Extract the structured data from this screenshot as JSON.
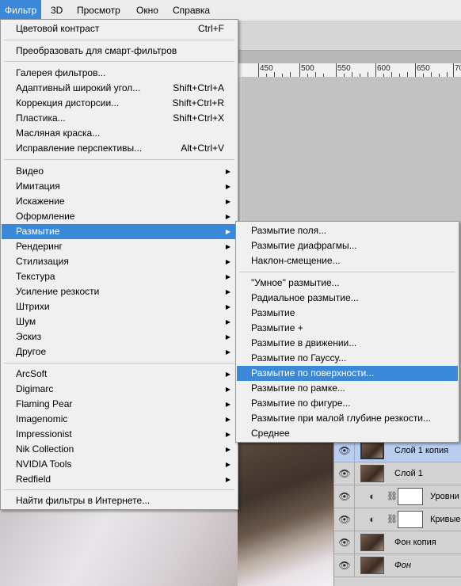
{
  "menubar": {
    "items": [
      {
        "label": "Фильтр",
        "active": true
      },
      {
        "label": "3D"
      },
      {
        "label": "Просмотр"
      },
      {
        "label": "Окно"
      },
      {
        "label": "Справка"
      }
    ]
  },
  "ruler": {
    "labels": [
      "450",
      "500",
      "550",
      "600",
      "650",
      "70"
    ]
  },
  "filter_menu": {
    "items": [
      {
        "label": "Цветовой контраст",
        "shortcut": "Ctrl+F"
      },
      {
        "label": "Преобразовать для смарт-фильтров"
      },
      {
        "label": "Галерея фильтров..."
      },
      {
        "label": "Адаптивный широкий угол...",
        "shortcut": "Shift+Ctrl+A"
      },
      {
        "label": "Коррекция дисторсии...",
        "shortcut": "Shift+Ctrl+R"
      },
      {
        "label": "Пластика...",
        "shortcut": "Shift+Ctrl+X"
      },
      {
        "label": "Масляная краска..."
      },
      {
        "label": "Исправление перспективы...",
        "shortcut": "Alt+Ctrl+V"
      },
      {
        "label": "Видео",
        "submenu": true
      },
      {
        "label": "Имитация",
        "submenu": true
      },
      {
        "label": "Искажение",
        "submenu": true
      },
      {
        "label": "Оформление",
        "submenu": true
      },
      {
        "label": "Размытие",
        "submenu": true,
        "highlighted": true
      },
      {
        "label": "Рендеринг",
        "submenu": true
      },
      {
        "label": "Стилизация",
        "submenu": true
      },
      {
        "label": "Текстура",
        "submenu": true
      },
      {
        "label": "Усиление резкости",
        "submenu": true
      },
      {
        "label": "Штрихи",
        "submenu": true
      },
      {
        "label": "Шум",
        "submenu": true
      },
      {
        "label": "Эскиз",
        "submenu": true
      },
      {
        "label": "Другое",
        "submenu": true
      },
      {
        "label": "ArcSoft",
        "submenu": true
      },
      {
        "label": "Digimarc",
        "submenu": true
      },
      {
        "label": "Flaming Pear",
        "submenu": true
      },
      {
        "label": "Imagenomic",
        "submenu": true
      },
      {
        "label": "Impressionist",
        "submenu": true
      },
      {
        "label": "Nik Collection",
        "submenu": true
      },
      {
        "label": "NVIDIA Tools",
        "submenu": true
      },
      {
        "label": "Redfield",
        "submenu": true
      },
      {
        "label": "Найти фильтры в Интернете..."
      }
    ]
  },
  "blur_submenu": {
    "items": [
      {
        "label": "Размытие поля..."
      },
      {
        "label": "Размытие диафрагмы..."
      },
      {
        "label": "Наклон-смещение..."
      },
      {
        "label": "\"Умное\" размытие..."
      },
      {
        "label": "Радиальное размытие..."
      },
      {
        "label": "Размытие"
      },
      {
        "label": "Размытие +"
      },
      {
        "label": "Размытие в движении..."
      },
      {
        "label": "Размытие по Гауссу..."
      },
      {
        "label": "Размытие по поверхности...",
        "highlighted": true
      },
      {
        "label": "Размытие по рамке..."
      },
      {
        "label": "Размытие по фигуре..."
      },
      {
        "label": "Размытие при малой глубине резкости..."
      },
      {
        "label": "Среднее"
      }
    ]
  },
  "layers": [
    {
      "name": "Слой 1 копия",
      "type": "pixel",
      "selected": true
    },
    {
      "name": "Слой 1",
      "type": "pixel"
    },
    {
      "name": "Уровни",
      "type": "adjustment"
    },
    {
      "name": "Кривые",
      "type": "adjustment"
    },
    {
      "name": "Фон копия",
      "type": "pixel"
    },
    {
      "name": "Фон",
      "type": "pixel",
      "italic": true
    }
  ],
  "icons": {
    "eye": "eye-icon",
    "adjustment": "adjustment-layer-icon",
    "link": "chain-link-icon",
    "arrow": "submenu-arrow-icon"
  },
  "colors": {
    "highlight": "#3a89d8",
    "menu_bg": "#f0f0f0",
    "selected_layer": "#b8cdf0"
  }
}
